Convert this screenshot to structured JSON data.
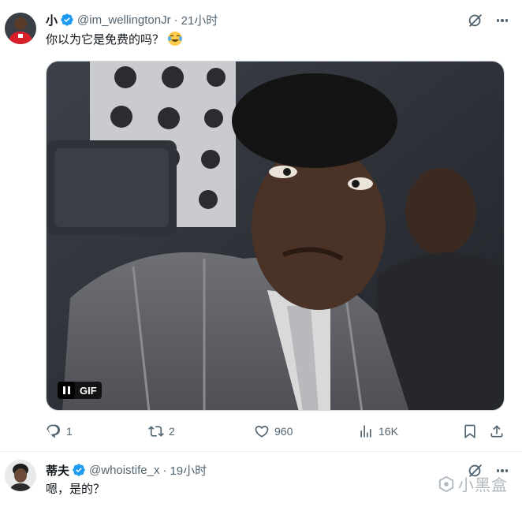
{
  "tweets": [
    {
      "display_name": "小",
      "handle": "@im_wellingtonJr",
      "separator": "·",
      "time": "21小时",
      "text": "你以为它是免费的吗？",
      "emoji": "joy-emoji",
      "media": {
        "type": "gif",
        "badge": "GIF"
      },
      "actions": {
        "replies": "1",
        "retweets": "2",
        "likes": "960",
        "views": "16K"
      }
    },
    {
      "display_name": "蒂夫",
      "handle": "@whoistife_x",
      "separator": "·",
      "time": "19小时",
      "text": "嗯，是的？"
    }
  ],
  "watermark": "小黑盒",
  "colors": {
    "verified": "#1d9bf0",
    "secondary_text": "#536471",
    "primary_text": "#0f1419"
  },
  "icons": [
    "grok-icon",
    "more-icon",
    "reply-icon",
    "retweet-icon",
    "like-icon",
    "views-icon",
    "bookmark-icon",
    "share-icon",
    "pause-icon"
  ]
}
